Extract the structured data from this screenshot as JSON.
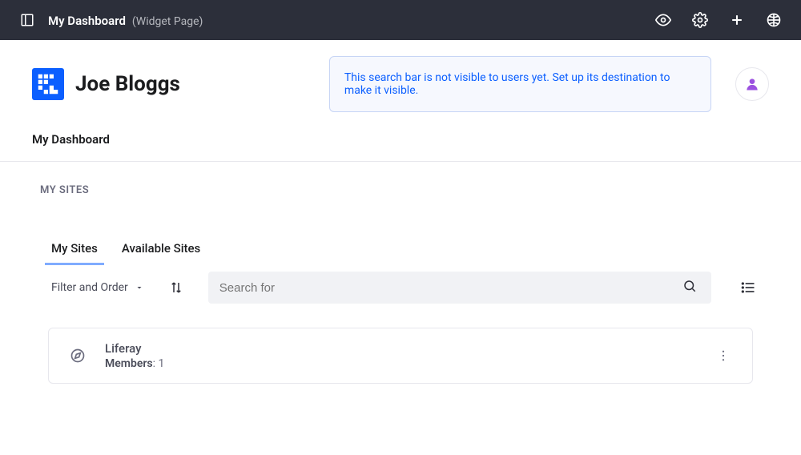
{
  "topbar": {
    "title": "My Dashboard",
    "subtitle": "(Widget Page)"
  },
  "header": {
    "brand_name": "Joe Bloggs",
    "search_notice_text": "This search bar is not visible to users yet. ",
    "search_notice_link": "Set up its destination to make it visible."
  },
  "breadcrumb": {
    "current": "My Dashboard"
  },
  "section": {
    "title": "MY SITES"
  },
  "tabs": [
    {
      "label": "My Sites",
      "active": true
    },
    {
      "label": "Available Sites",
      "active": false
    }
  ],
  "controls": {
    "filter_label": "Filter and Order",
    "search_placeholder": "Search for"
  },
  "sites": [
    {
      "name": "Liferay",
      "members_label": "Members",
      "members_count": "1"
    }
  ]
}
